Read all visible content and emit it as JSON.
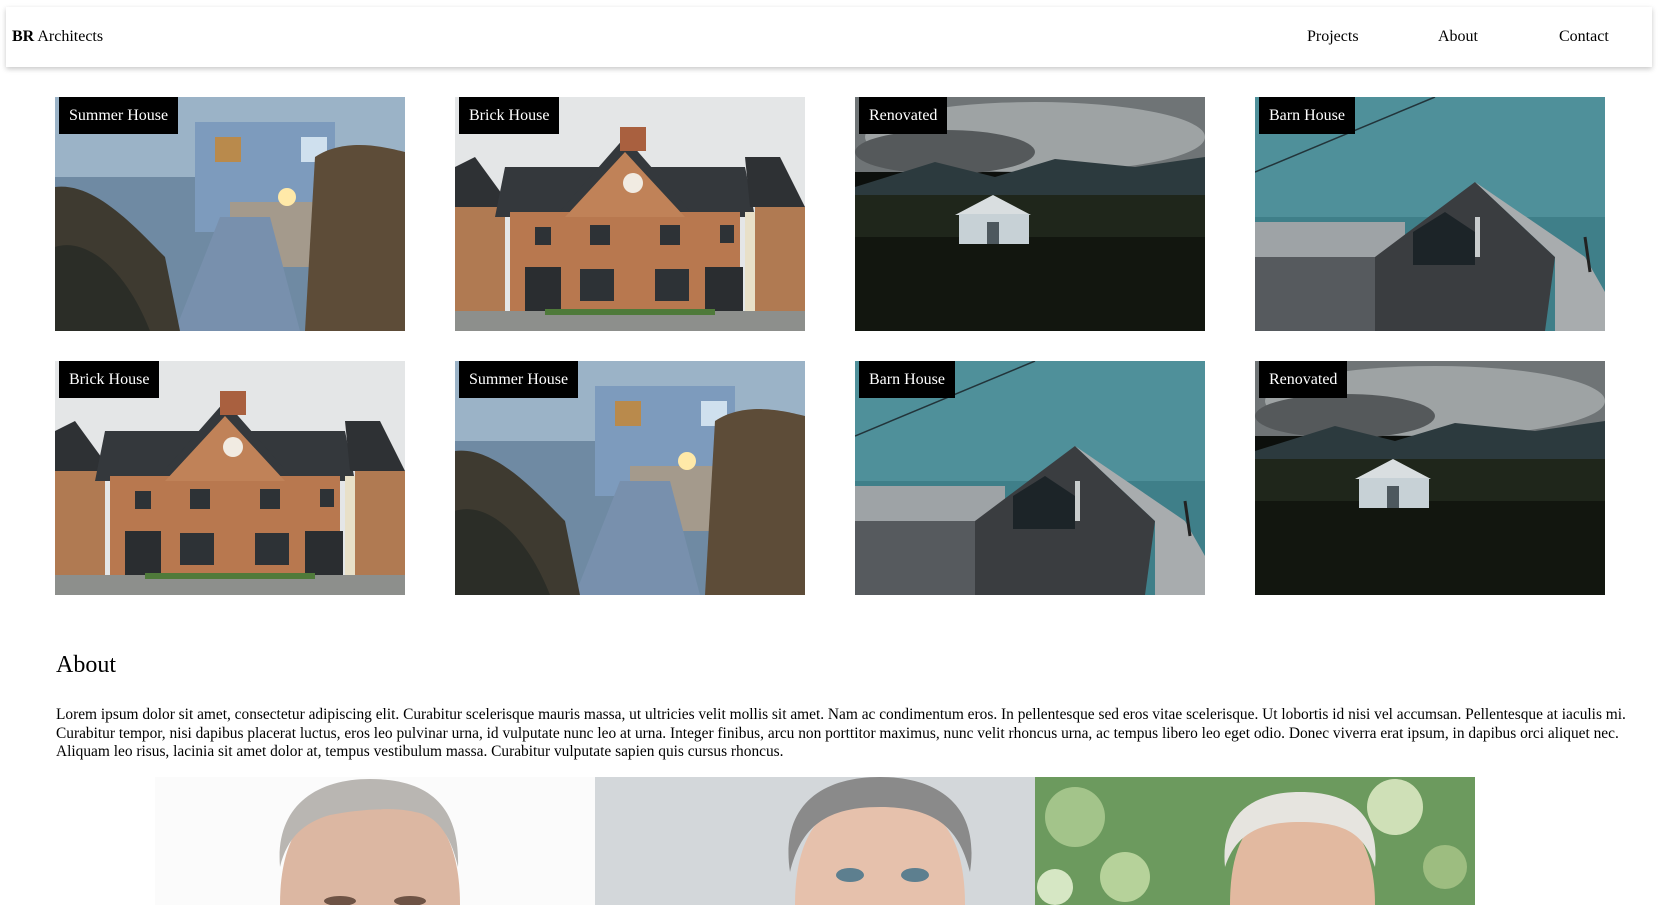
{
  "navbar": {
    "brand_bold": "BR",
    "brand_rest": " Architects",
    "links": [
      "Projects",
      "About",
      "Contact"
    ]
  },
  "projects": [
    {
      "title": "Summer House",
      "scene": "summer-house-photo"
    },
    {
      "title": "Brick House",
      "scene": "brick-house-photo"
    },
    {
      "title": "Renovated",
      "scene": "renovated-house-photo"
    },
    {
      "title": "Barn House",
      "scene": "barn-house-photo"
    },
    {
      "title": "Brick House",
      "scene": "brick-house-photo"
    },
    {
      "title": "Summer House",
      "scene": "summer-house-photo"
    },
    {
      "title": "Barn House",
      "scene": "barn-house-photo"
    },
    {
      "title": "Renovated",
      "scene": "renovated-house-photo"
    }
  ],
  "about": {
    "heading": "About",
    "text": "Lorem ipsum dolor sit amet, consectetur adipiscing elit. Curabitur scelerisque mauris massa, ut ultricies velit mollis sit amet. Nam ac condimentum eros. In pellentesque sed eros vitae scelerisque. Ut lobortis id nisi vel accumsan. Pellentesque at iaculis mi. Curabitur tempor, nisi dapibus placerat luctus, eros leo pulvinar urna, id vulputate nunc leo at urna. Integer finibus, arcu non porttitor maximus, nunc velit rhoncus urna, ac tempus libero leo eget odio. Donec viverra erat ipsum, in dapibus orci aliquet nec. Aliquam leo risus, lacinia sit amet dolor at, tempus vestibulum massa. Curabitur vulputate sapien quis cursus rhoncus."
  },
  "team_photos": [
    "team-member-1-photo",
    "team-member-2-photo",
    "team-member-3-photo"
  ]
}
